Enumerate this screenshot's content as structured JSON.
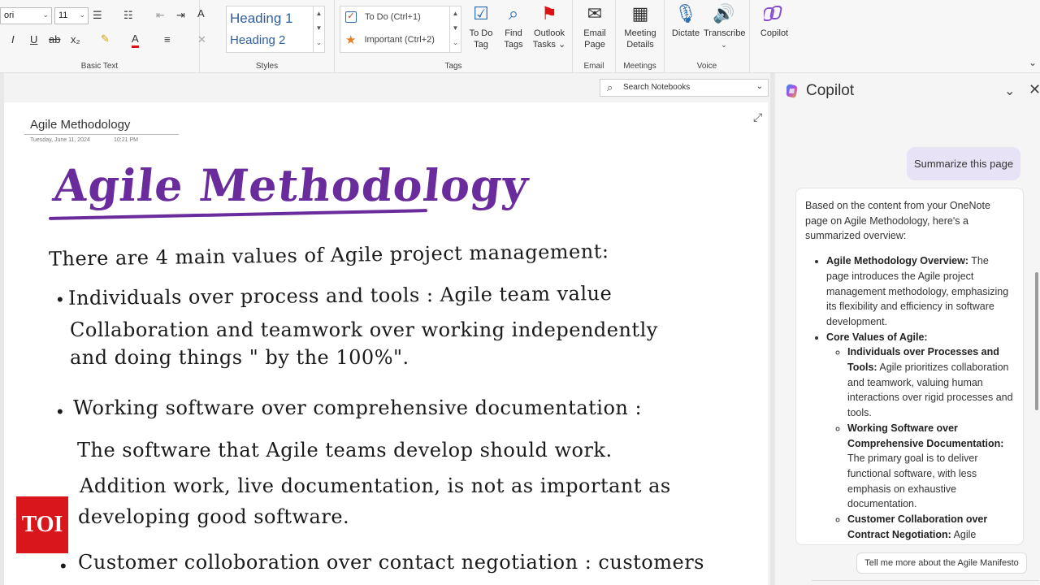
{
  "ribbon": {
    "font_name": "ori",
    "font_size": "11",
    "basic_text_label": "Basic Text",
    "styles": {
      "h1": "Heading 1",
      "h2": "Heading 2",
      "label": "Styles"
    },
    "tags": {
      "todo": "To Do (Ctrl+1)",
      "important": "Important (Ctrl+2)",
      "label": "Tags"
    },
    "todo_tag": "To Do\nTag",
    "find_tags": "Find\nTags",
    "outlook_tasks": "Outlook\nTasks ⌄",
    "email_page": "Email\nPage",
    "email_label": "Email",
    "meeting_details": "Meeting\nDetails",
    "meetings_label": "Meetings",
    "dictate": "Dictate",
    "transcribe": "Transcribe",
    "voice_label": "Voice",
    "copilot": "Copilot"
  },
  "search": {
    "placeholder": "Search Notebooks"
  },
  "page": {
    "title": "Agile Methodology",
    "date": "Tuesday, June 11, 2024",
    "time": "10:21 PM",
    "ink": {
      "heading": "Agile Methodology",
      "intro": "There are 4 main values of Agile project management:",
      "b1_l1": "Individuals over process and tools : Agile team value",
      "b1_l2": "Collaboration and teamwork over working independently",
      "b1_l3": "and doing things \" by the 100%\".",
      "b2_l1": "Working software over comprehensive documentation :",
      "b2_l2": "The software that Agile teams develop should work.",
      "b2_l3": "Addition work, live documentation, is not as important as",
      "b2_l4": "developing good software.",
      "b3_l1": "Customer colloboration over contact negotiation : customers"
    }
  },
  "copilot": {
    "title": "Copilot",
    "user_message": "Summarize this page",
    "reply_intro": "Based on the content from your OneNote page on Agile Methodology, here's a summarized overview:",
    "item1_bold": "Agile Methodology Overview:",
    "item1_text": " The page introduces the Agile project management methodology, emphasizing its flexibility and efficiency in software development.",
    "item2_bold": "Core Values of Agile:",
    "sub1_bold": "Individuals over Processes and Tools:",
    "sub1_text": " Agile prioritizes collaboration and teamwork, valuing human interactions over rigid processes and tools.",
    "sub2_bold": "Working Software over Comprehensive Documentation:",
    "sub2_text": " The primary goal is to deliver functional software, with less emphasis on exhaustive documentation.",
    "sub3_bold": "Customer Collaboration over Contract Negotiation:",
    "sub3_text": " Agile",
    "suggestion": "Tell me more about the Agile Manifesto"
  },
  "watermark": "TOI",
  "colors": {
    "ink_heading": "#6a2c9c",
    "copilot_user_bubble": "#e8e2f6",
    "toi_red": "#d8161c"
  }
}
